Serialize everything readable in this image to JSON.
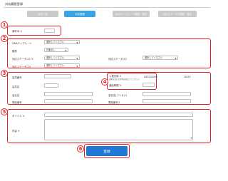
{
  "page": {
    "title": "対応履歴登録"
  },
  "tabs": [
    {
      "label": "対応一覧"
    },
    {
      "label": "対応登録"
    },
    {
      "label": "Q&Aテンプレート閲覧・修正"
    },
    {
      "label": "対応ステータス閲覧・修正"
    }
  ],
  "markers": [
    "1",
    "2",
    "3",
    "4",
    "5",
    "6"
  ],
  "section1": {
    "case_no_label": "案件ID"
  },
  "section2": {
    "qa_template": {
      "label": "Q&Aテンプレート",
      "value": "選択してください"
    },
    "category": {
      "label": "種別",
      "value": "対象なし"
    },
    "status1": {
      "label": "対応ステータス1",
      "value": "選択してください"
    },
    "status2": {
      "label": "対応ステータス2",
      "value": "選択してください"
    },
    "status3": {
      "label": "対応ステータス3",
      "value": "選択してください"
    }
  },
  "section3": {
    "member_no_label": "会員番号",
    "member_name_label": "会員名",
    "company_label": "会社名",
    "company_kana_label": "会社名(フリガナ)",
    "phone1_label": "電話番号",
    "phone2_label": "電話番号２"
  },
  "section4": {
    "received_label": "入電日時",
    "received_note": "通知を受ける日時を指定してください",
    "received_date": "2022/04/02",
    "received_time": "10:03",
    "end_label": "通話時間"
  },
  "section5": {
    "title_label": "タイトル",
    "content_label": "内容"
  },
  "submit": {
    "label": "登録"
  },
  "required_mark": "※",
  "select_caret": "▼"
}
